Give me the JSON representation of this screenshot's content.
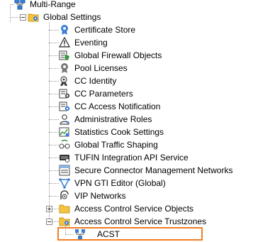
{
  "tree": {
    "root": {
      "label": "Multi-Range",
      "icon": "network-range-icon"
    },
    "global": {
      "label": "Global Settings",
      "icon": "settings-folder-icon"
    },
    "items": [
      {
        "label": "Certificate Store",
        "icon": "certificate-icon"
      },
      {
        "label": "Eventing",
        "icon": "warning-icon"
      },
      {
        "label": "Global Firewall Objects",
        "icon": "firewall-objects-icon"
      },
      {
        "label": "Pool Licenses",
        "icon": "license-icon"
      },
      {
        "label": "CC Identity",
        "icon": "identity-icon"
      },
      {
        "label": "CC Parameters",
        "icon": "parameters-icon"
      },
      {
        "label": "CC Access Notification",
        "icon": "access-notification-icon"
      },
      {
        "label": "Administrative Roles",
        "icon": "admin-roles-icon"
      },
      {
        "label": "Statistics Cook Settings",
        "icon": "statistics-icon"
      },
      {
        "label": "Global Traffic Shaping",
        "icon": "traffic-shaping-icon"
      },
      {
        "label": "TUFIN Integration API Service",
        "icon": "api-service-icon"
      },
      {
        "label": "Secure Connector Management Networks",
        "icon": "secure-connector-icon"
      },
      {
        "label": "VPN GTI Editor (Global)",
        "icon": "vpn-gti-icon"
      },
      {
        "label": "VIP Networks",
        "icon": "vip-networks-icon"
      },
      {
        "label": "Access Control Service Objects",
        "icon": "folder-icon"
      },
      {
        "label": "Access Control Service Trustzones",
        "icon": "settings-folder-icon"
      }
    ],
    "child": {
      "label": "ACST",
      "icon": "trustzone-network-icon"
    }
  },
  "colors": {
    "highlight": "#f07c24",
    "folder": "#f5c342",
    "gear": "#3a7fd5",
    "connector": "#9c9c9c"
  }
}
